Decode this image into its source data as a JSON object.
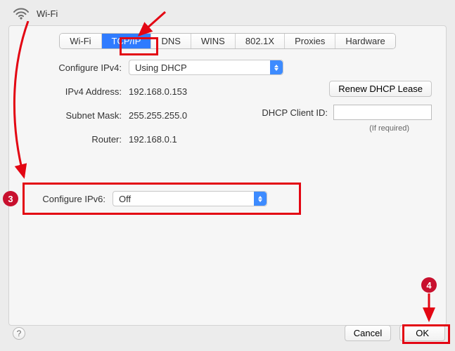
{
  "header": {
    "title": "Wi-Fi"
  },
  "tabs": [
    "Wi-Fi",
    "TCP/IP",
    "DNS",
    "WINS",
    "802.1X",
    "Proxies",
    "Hardware"
  ],
  "active_tab_index": 1,
  "ipv4": {
    "configure_label": "Configure IPv4:",
    "configure_value": "Using DHCP",
    "address_label": "IPv4 Address:",
    "address_value": "192.168.0.153",
    "subnet_label": "Subnet Mask:",
    "subnet_value": "255.255.255.0",
    "router_label": "Router:",
    "router_value": "192.168.0.1",
    "renew_label": "Renew DHCP Lease",
    "clientid_label": "DHCP Client ID:",
    "clientid_value": "",
    "ifrequired": "(If required)"
  },
  "ipv6": {
    "configure_label": "Configure IPv6:",
    "configure_value": "Off"
  },
  "footer": {
    "cancel": "Cancel",
    "ok": "OK",
    "help": "?"
  },
  "annotations": {
    "step3": "3",
    "step4": "4"
  }
}
